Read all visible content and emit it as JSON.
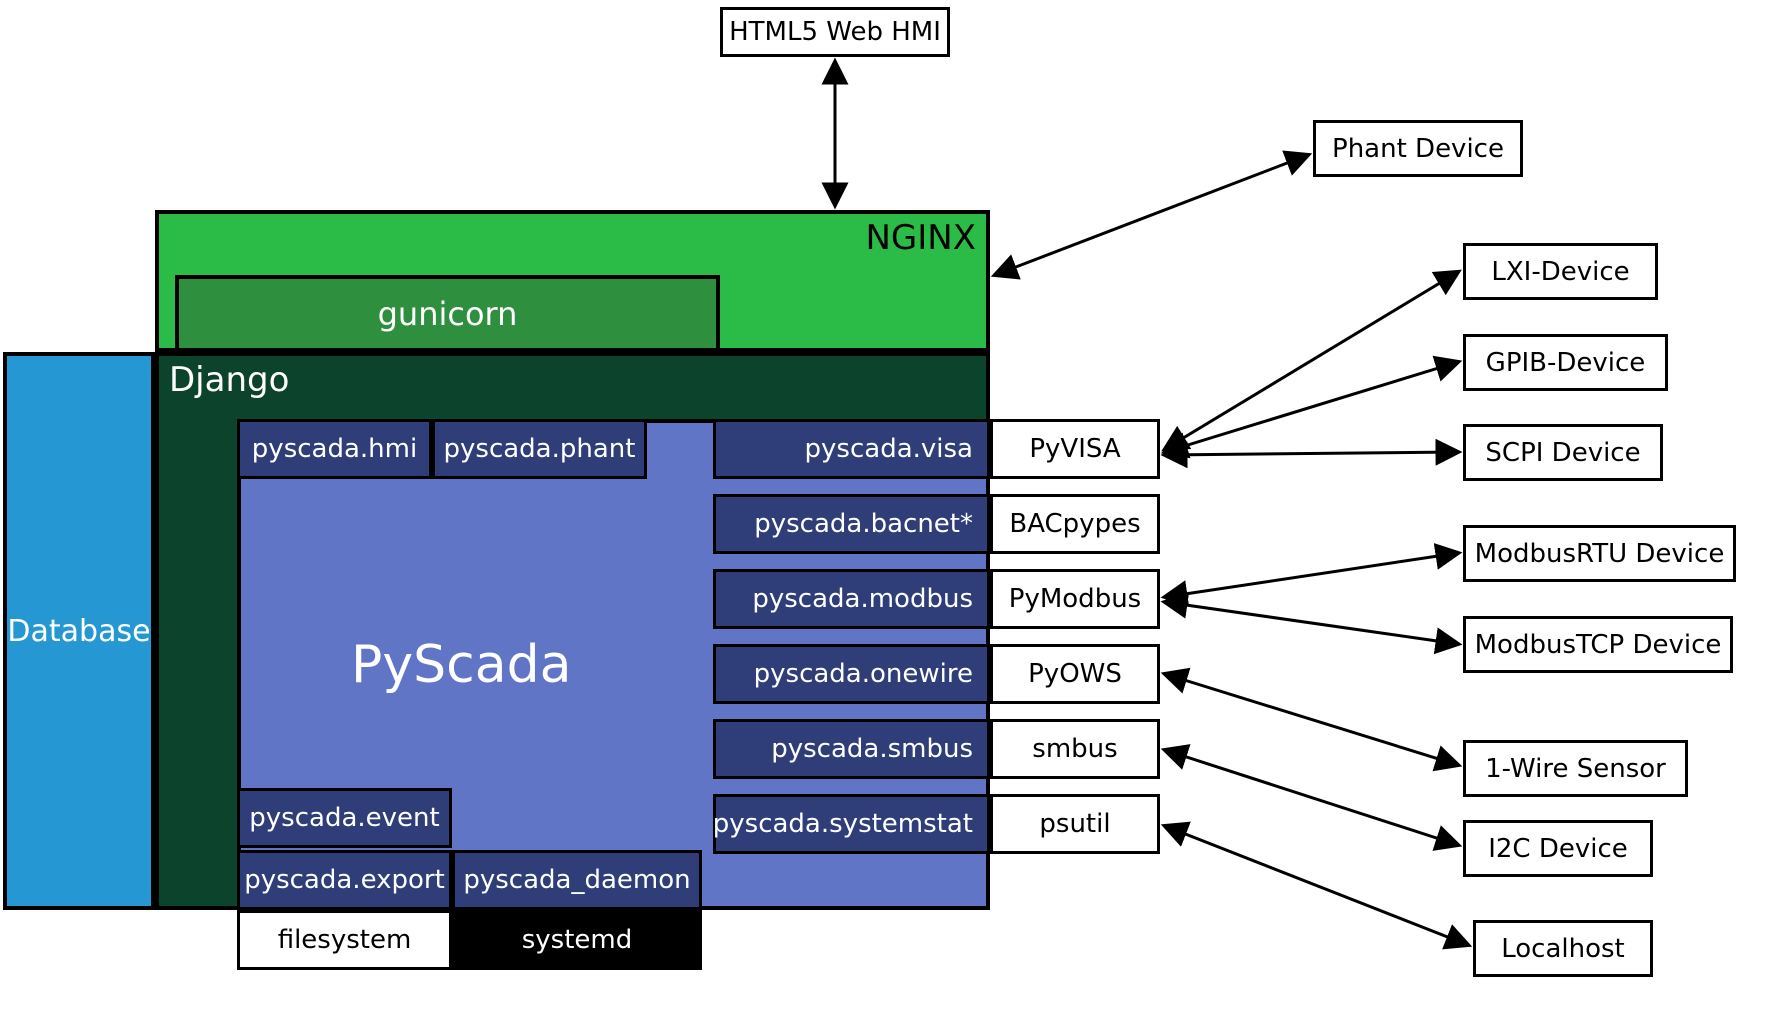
{
  "top": {
    "html5": "HTML5 Web HMI"
  },
  "nginx": {
    "label": "NGINX"
  },
  "gunicorn": {
    "label": "gunicorn"
  },
  "django": {
    "label": "Django"
  },
  "database": {
    "label": "Database"
  },
  "pyscada": {
    "core": "PyScada",
    "modules": {
      "hmi": "pyscada.hmi",
      "phant": "pyscada.phant",
      "visa": "pyscada.visa",
      "bacnet": "pyscada.bacnet*",
      "modbus": "pyscada.modbus",
      "onewire": "pyscada.onewire",
      "smbus": "pyscada.smbus",
      "systemstat": "pyscada.systemstat",
      "event": "pyscada.event",
      "export": "pyscada.export",
      "daemon": "pyscada_daemon"
    }
  },
  "libs": {
    "pyvisa": "PyVISA",
    "bacpypes": "BACpypes",
    "pymodbus": "PyModbus",
    "pyows": "PyOWS",
    "smbus": "smbus",
    "psutil": "psutil"
  },
  "system": {
    "filesystem": "filesystem",
    "systemd": "systemd"
  },
  "devices": {
    "phant": "Phant Device",
    "lxi": "LXI-Device",
    "gpib": "GPIB-Device",
    "scpi": "SCPI Device",
    "modbus_rtu": "ModbusRTU Device",
    "modbus_tcp": "ModbusTCP Device",
    "onewire": "1-Wire Sensor",
    "i2c": "I2C Device",
    "localhost": "Localhost"
  }
}
